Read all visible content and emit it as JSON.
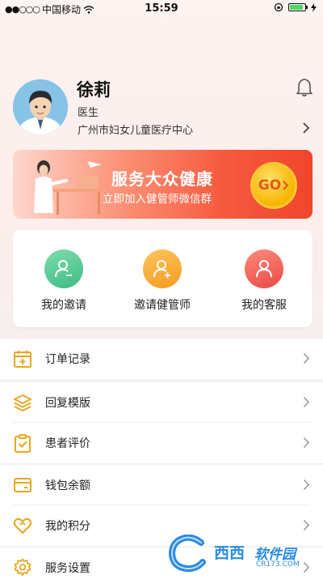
{
  "status_bar": {
    "carrier": "中国移动",
    "time": "15:59"
  },
  "profile": {
    "name": "徐莉",
    "role": "医生",
    "hospital": "广州市妇女儿童医疗中心"
  },
  "banner": {
    "title": "服务大众健康",
    "subtitle": "立即加入健管师微信群",
    "go_label": "GO"
  },
  "actions": [
    {
      "label": "我的邀请",
      "color": "#4cc98f"
    },
    {
      "label": "邀请健管师",
      "color": "#f7a531"
    },
    {
      "label": "我的客服",
      "color": "#ef5d55"
    }
  ],
  "menu": {
    "orders": "订单记录",
    "reply_templates": "回复模版",
    "patient_reviews": "患者评价",
    "wallet_balance": "钱包余额",
    "my_points": "我的积分",
    "service_settings": "服务设置"
  },
  "watermark": {
    "text1": "西西",
    "text2": "软件园",
    "url": "CR173.COM"
  },
  "colors": {
    "accent": "#e8a71e",
    "banner_red": "#f0452d"
  }
}
